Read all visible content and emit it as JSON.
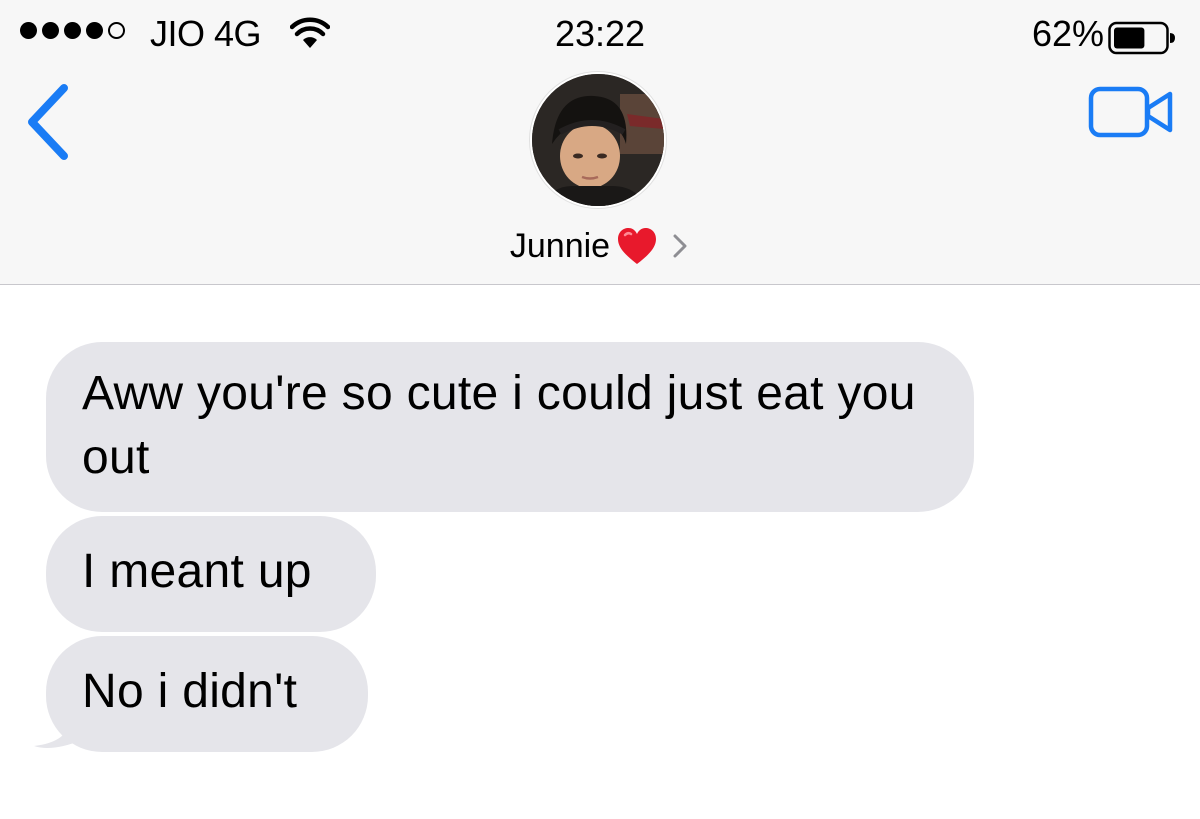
{
  "status_bar": {
    "carrier": "JIO 4G",
    "time": "23:22",
    "battery_percent": "62%",
    "signal_bars_filled": 4,
    "signal_bars_total": 5,
    "battery_level": 0.62
  },
  "nav": {
    "back_icon": "chevron-left-icon",
    "video_icon": "video-camera-icon",
    "accent_color": "#1a7cf5"
  },
  "contact": {
    "name": "Junnie",
    "emoji": "heart-icon",
    "emoji_color": "#e8192c"
  },
  "messages": [
    {
      "direction": "incoming",
      "text": "Aww you're so cute i could just eat you out"
    },
    {
      "direction": "incoming",
      "text": "I meant up"
    },
    {
      "direction": "incoming",
      "text": "No i didn't"
    }
  ],
  "colors": {
    "incoming_bubble": "#e5e5ea",
    "header_background": "#f7f7f7"
  }
}
